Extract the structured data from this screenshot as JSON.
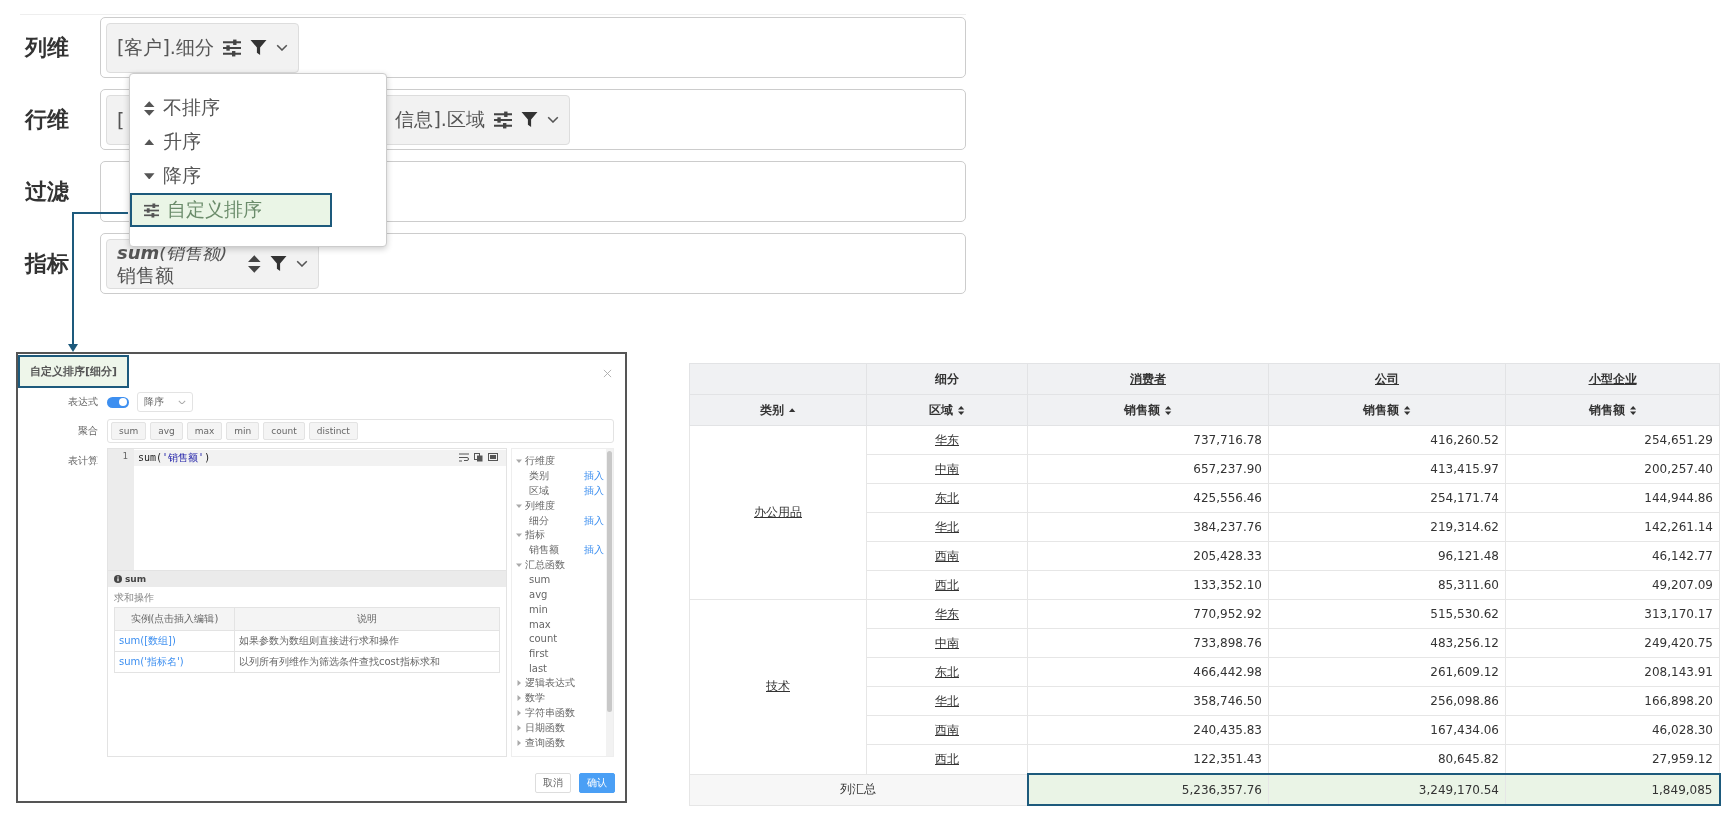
{
  "config": {
    "rows": [
      {
        "label": "列维",
        "chips": [
          {
            "kind": "single",
            "parts": [
              "[客户].细分"
            ],
            "sort_icon": {
              "kind": "custom"
            }
          }
        ]
      },
      {
        "label": "行维",
        "chips": [
          {
            "kind": "split",
            "parts": [
              "[",
              "信息].区域"
            ],
            "sort_icon": {
              "kind": "custom"
            }
          }
        ]
      },
      {
        "label": "过滤"
      },
      {
        "label": "指标",
        "chips": [
          {
            "kind": "stacked",
            "parts": [
              "**sum**(销售额)",
              "销售额"
            ],
            "sort_icon": {
              "kind": "none"
            }
          }
        ]
      }
    ],
    "menu": {
      "items": [
        {
          "label": "不排序",
          "kind": "none",
          "selected": false
        },
        {
          "label": "升序",
          "kind": "asc",
          "selected": false
        },
        {
          "label": "降序",
          "kind": "desc",
          "selected": false
        },
        {
          "label": "自定义排序",
          "kind": "custom",
          "selected": true
        }
      ]
    }
  },
  "dialog": {
    "title": "自定义排序[细分]",
    "expression": {
      "label": "表达式",
      "on": true,
      "select": "降序"
    },
    "aggregate": {
      "label": "聚合",
      "buttons": [
        "sum",
        "avg",
        "max",
        "min",
        "count",
        "distinct"
      ]
    },
    "calc": {
      "label": "表计算",
      "line_numbers": [
        "1"
      ],
      "code": [
        {
          "kind": "plain",
          "text": "sum("
        },
        {
          "kind": "string",
          "text": "'销售额'"
        },
        {
          "kind": "plain",
          "text": ")"
        }
      ]
    },
    "tree": [
      {
        "label": "行维度",
        "expanded": true,
        "children": [
          {
            "label": "类别",
            "action": "插入"
          },
          {
            "label": "区域",
            "action": "插入"
          }
        ]
      },
      {
        "label": "列维度",
        "expanded": true,
        "children": [
          {
            "label": "细分",
            "action": "插入"
          }
        ]
      },
      {
        "label": "指标",
        "expanded": true,
        "children": [
          {
            "label": "销售额",
            "action": "插入"
          }
        ]
      },
      {
        "label": "汇总函数",
        "expanded": true,
        "children": [
          {
            "label": "sum"
          },
          {
            "label": "avg"
          },
          {
            "label": "min"
          },
          {
            "label": "max"
          },
          {
            "label": "count"
          },
          {
            "label": "first"
          },
          {
            "label": "last"
          }
        ]
      },
      {
        "label": "逻辑表达式",
        "expanded": false
      },
      {
        "label": "数学",
        "expanded": false
      },
      {
        "label": "字符串函数",
        "expanded": false
      },
      {
        "label": "日期函数",
        "expanded": false
      },
      {
        "label": "查询函数",
        "expanded": false
      }
    ],
    "help": {
      "title": "sum",
      "subtitle": "求和操作",
      "columns": [
        "实例(点击插入编辑)",
        "说明"
      ],
      "rows": [
        [
          "sum([数组])",
          "如果参数为数组则直接进行求和操作"
        ],
        [
          "sum('指标名')",
          "以列所有列维作为筛选条件查找cost指标求和"
        ]
      ]
    },
    "buttons": [
      {
        "label": "取消",
        "kind": "default"
      },
      {
        "label": "确认",
        "kind": "primary"
      }
    ]
  },
  "pivot": {
    "dim_header": "细分",
    "segments": [
      "消费者",
      "公司",
      "小型企业"
    ],
    "row_headers": [
      {
        "label": "类别",
        "kind": "asc"
      },
      {
        "label": "区域",
        "kind": "none"
      }
    ],
    "measure_headers": [
      {
        "label": "销售额",
        "kind": "none"
      },
      {
        "label": "销售额",
        "kind": "none"
      },
      {
        "label": "销售额",
        "kind": "none"
      }
    ],
    "groups": [
      {
        "category": "办公用品",
        "rows": [
          {
            "region": "华东",
            "values": [
              "737,716.78",
              "416,260.52",
              "254,651.29"
            ]
          },
          {
            "region": "中南",
            "values": [
              "657,237.90",
              "413,415.97",
              "200,257.40"
            ]
          },
          {
            "region": "东北",
            "values": [
              "425,556.46",
              "254,171.74",
              "144,944.86"
            ]
          },
          {
            "region": "华北",
            "values": [
              "384,237.76",
              "219,314.62",
              "142,261.14"
            ]
          },
          {
            "region": "西南",
            "values": [
              "205,428.33",
              "96,121.48",
              "46,142.77"
            ]
          },
          {
            "region": "西北",
            "values": [
              "133,352.10",
              "85,311.60",
              "49,207.09"
            ]
          }
        ]
      },
      {
        "category": "技术",
        "rows": [
          {
            "region": "华东",
            "values": [
              "770,952.92",
              "515,530.62",
              "313,170.17"
            ]
          },
          {
            "region": "中南",
            "values": [
              "733,898.76",
              "483,256.12",
              "249,420.75"
            ]
          },
          {
            "region": "东北",
            "values": [
              "466,442.98",
              "261,609.12",
              "208,143.91"
            ]
          },
          {
            "region": "华北",
            "values": [
              "358,746.50",
              "256,098.86",
              "166,898.20"
            ]
          },
          {
            "region": "西南",
            "values": [
              "240,435.83",
              "167,434.06",
              "46,028.30"
            ]
          },
          {
            "region": "西北",
            "values": [
              "122,351.43",
              "80,645.82",
              "27,959.12"
            ]
          }
        ]
      }
    ],
    "total": {
      "label": "列汇总",
      "highlighted": true,
      "values": [
        "5,236,357.76",
        "3,249,170.54",
        "1,849,085"
      ]
    }
  }
}
